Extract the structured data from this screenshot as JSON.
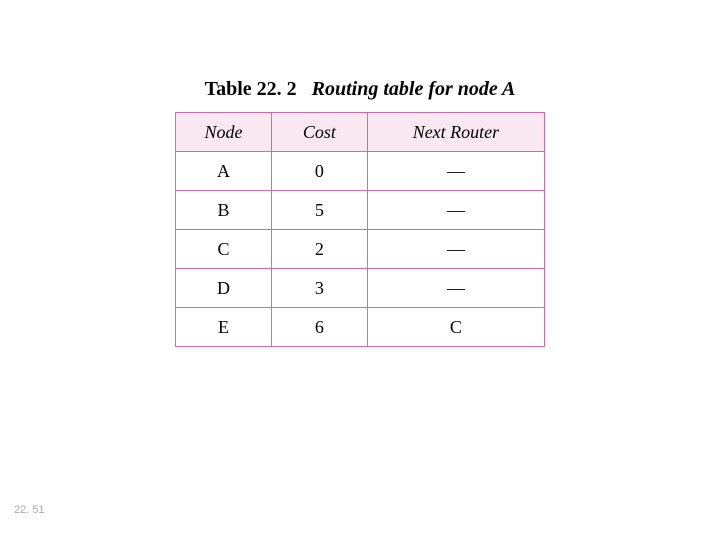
{
  "caption": {
    "table_number": "Table 22. 2",
    "title": "Routing table for node A"
  },
  "table": {
    "headers": {
      "node": "Node",
      "cost": "Cost",
      "next_router": "Next Router"
    },
    "rows": [
      {
        "node": "A",
        "cost": "0",
        "next_router": "—"
      },
      {
        "node": "B",
        "cost": "5",
        "next_router": "—"
      },
      {
        "node": "C",
        "cost": "2",
        "next_router": "—"
      },
      {
        "node": "D",
        "cost": "3",
        "next_router": "—"
      },
      {
        "node": "E",
        "cost": "6",
        "next_router": "C"
      }
    ]
  },
  "page_number": "22. 51",
  "chart_data": {
    "type": "table",
    "title": "Routing table for node A",
    "columns": [
      "Node",
      "Cost",
      "Next Router"
    ],
    "rows": [
      [
        "A",
        0,
        null
      ],
      [
        "B",
        5,
        null
      ],
      [
        "C",
        2,
        null
      ],
      [
        "D",
        3,
        null
      ],
      [
        "E",
        6,
        "C"
      ]
    ]
  }
}
